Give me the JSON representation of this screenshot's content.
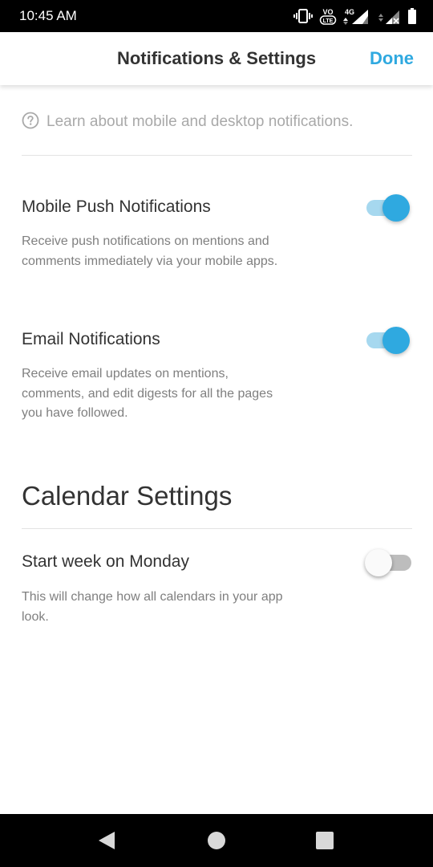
{
  "status_bar": {
    "time": "10:45 AM",
    "icons": [
      "vibrate-icon",
      "volte-icon",
      "4g-signal-icon",
      "no-signal-icon",
      "battery-icon"
    ],
    "network_label": "4G",
    "volte_label": "VO LTE"
  },
  "header": {
    "title": "Notifications & Settings",
    "done_label": "Done"
  },
  "learn_link": {
    "icon": "help-circle-icon",
    "text": "Learn about mobile and desktop notifications."
  },
  "notifications": [
    {
      "title": "Mobile Push Notifications",
      "description": "Receive push notifications on mentions and comments immediately via your mobile apps.",
      "enabled": true
    },
    {
      "title": "Email Notifications",
      "description": "Receive email updates on mentions, comments, and edit digests for all the pages you have followed.",
      "enabled": true
    }
  ],
  "calendar": {
    "heading": "Calendar Settings",
    "setting": {
      "title": "Start week on Monday",
      "description": "This will change how all calendars in your app look.",
      "enabled": false
    }
  },
  "nav_bar": {
    "icons": [
      "back-icon",
      "home-icon",
      "recents-icon"
    ]
  },
  "colors": {
    "accent": "#2fa9e0",
    "track_on": "#a6d8ef",
    "title_text": "#333333",
    "muted_text": "#7f7f7f"
  }
}
